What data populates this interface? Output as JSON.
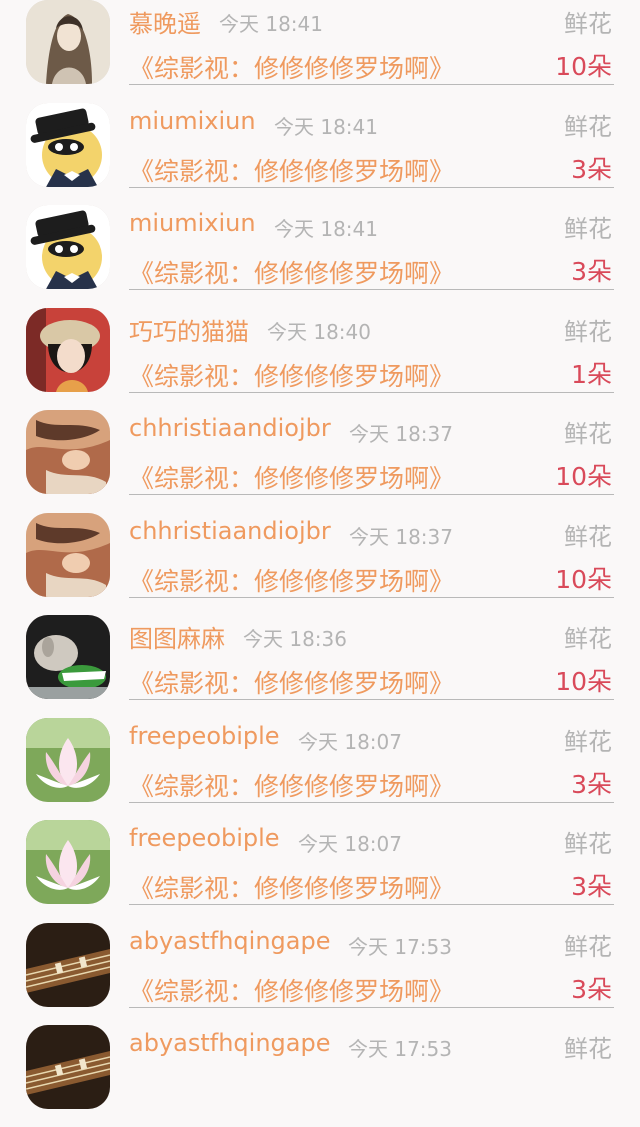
{
  "rows": [
    {
      "name": "慕晚遥",
      "time": "今天 18:41",
      "gift": "鲜花",
      "book": "《综影视：修修修修罗场啊》",
      "count": "10朵",
      "avatar": "ink-portrait-avatar"
    },
    {
      "name": "miumixiun",
      "time": "今天 18:41",
      "gift": "鲜花",
      "book": "《综影视：修修修修罗场啊》",
      "count": "3朵",
      "avatar": "cartoon-detective-avatar"
    },
    {
      "name": "miumixiun",
      "time": "今天 18:41",
      "gift": "鲜花",
      "book": "《综影视：修修修修罗场啊》",
      "count": "3朵",
      "avatar": "cartoon-detective-avatar"
    },
    {
      "name": "巧巧的猫猫",
      "time": "今天 18:40",
      "gift": "鲜花",
      "book": "《综影视：修修修修罗场啊》",
      "count": "1朵",
      "avatar": "girl-hat-avatar"
    },
    {
      "name": "chhristiaandiojbr",
      "time": "今天 18:37",
      "gift": "鲜花",
      "book": "《综影视：修修修修罗场啊》",
      "count": "10朵",
      "avatar": "painting-avatar"
    },
    {
      "name": "chhristiaandiojbr",
      "time": "今天 18:37",
      "gift": "鲜花",
      "book": "《综影视：修修修修罗场啊》",
      "count": "10朵",
      "avatar": "painting-avatar"
    },
    {
      "name": "图图麻麻",
      "time": "今天 18:36",
      "gift": "鲜花",
      "book": "《综影视：修修修修罗场啊》",
      "count": "10朵",
      "avatar": "dog-toy-avatar"
    },
    {
      "name": "freepeobiple",
      "time": "今天 18:07",
      "gift": "鲜花",
      "book": "《综影视：修修修修罗场啊》",
      "count": "3朵",
      "avatar": "lotus-avatar"
    },
    {
      "name": "freepeobiple",
      "time": "今天 18:07",
      "gift": "鲜花",
      "book": "《综影视：修修修修罗场啊》",
      "count": "3朵",
      "avatar": "lotus-avatar"
    },
    {
      "name": "abyastfhqingape",
      "time": "今天 17:53",
      "gift": "鲜花",
      "book": "《综影视：修修修修罗场啊》",
      "count": "3朵",
      "avatar": "guzheng-avatar"
    },
    {
      "name": "abyastfhqingape",
      "time": "今天 17:53",
      "gift": "鲜花",
      "book": "",
      "count": "",
      "avatar": "guzheng-avatar"
    }
  ],
  "colors": {
    "accent": "#ef9a5f",
    "count": "#d94a5a",
    "muted": "#b4b4b4",
    "background": "#faf8f8"
  }
}
